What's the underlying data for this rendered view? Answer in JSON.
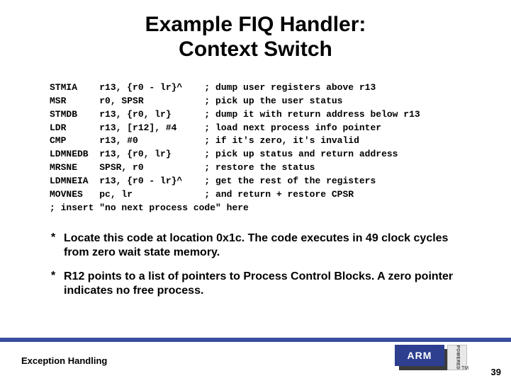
{
  "title_line1": "Example FIQ Handler:",
  "title_line2": "Context Switch",
  "code": "STMIA    r13, {r0 - lr}^    ; dump user registers above r13\nMSR      r0, SPSR           ; pick up the user status\nSTMDB    r13, {r0, lr}      ; dump it with return address below r13\nLDR      r13, [r12], #4     ; load next process info pointer\nCMP      r13, #0            ; if it's zero, it's invalid\nLDMNEDB  r13, {r0, lr}      ; pick up status and return address\nMRSNE    SPSR, r0           ; restore the status\nLDMNEIA  r13, {r0 - lr}^    ; get the rest of the registers\nMOVNES   pc, lr             ; and return + restore CPSR\n; insert \"no next process code\" here",
  "bullets": [
    "Locate this code at location 0x1c. The code executes in 49 clock cycles from zero wait state memory.",
    "R12 points to a list of pointers to Process Control Blocks. A zero pointer indicates no free process."
  ],
  "footer_label": "Exception Handling",
  "page_number": "39",
  "logo_text": "ARM",
  "powered_text": "POWERED",
  "tm": "TM"
}
